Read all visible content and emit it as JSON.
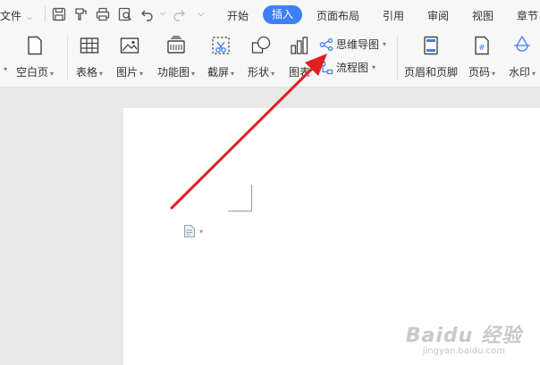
{
  "menubar": {
    "file_label": "文件",
    "tabs": [
      {
        "label": "开始"
      },
      {
        "label": "插入"
      },
      {
        "label": "页面布局"
      },
      {
        "label": "引用"
      },
      {
        "label": "审阅"
      },
      {
        "label": "视图"
      },
      {
        "label": "章节"
      }
    ],
    "active_tab": "插入"
  },
  "ribbon": {
    "blank_page": "空白页",
    "table": "表格",
    "picture": "图片",
    "function_chart": "功能图",
    "screenshot": "截屏",
    "shape": "形状",
    "chart": "图表",
    "mind_map": "思维导图",
    "flowchart": "流程图",
    "header_footer": "页眉和页脚",
    "page_number": "页码",
    "watermark": "水印"
  },
  "watermark": {
    "brand": "Baidu 经验",
    "url": "jingyan.baidu.com"
  },
  "colors": {
    "accent": "#3d7ff7",
    "arrow": "#e02020"
  }
}
